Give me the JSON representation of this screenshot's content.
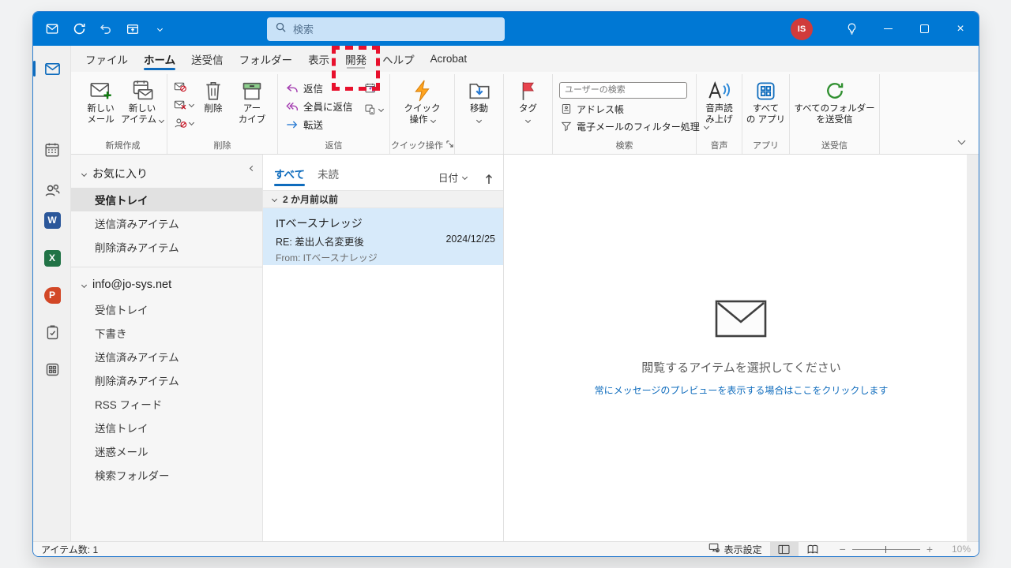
{
  "colors": {
    "accent": "#0078d4",
    "annotation": "#e8112d",
    "selection": "#d7eafa",
    "link": "#0f6cbd"
  },
  "titlebar": {
    "search_placeholder": "検索",
    "avatar_initials": "IS"
  },
  "tabs": {
    "items": [
      "ファイル",
      "ホーム",
      "送受信",
      "フォルダー",
      "表示",
      "開発",
      "ヘルプ",
      "Acrobat"
    ],
    "active": "ホーム",
    "annotated": "開発"
  },
  "ribbon": {
    "new_group": {
      "label": "新規作成",
      "new_mail_l1": "新しい",
      "new_mail_l2": "メール",
      "new_item_l1": "新しい",
      "new_item_l2": "アイテム"
    },
    "delete_group": {
      "label": "削除",
      "delete": "削除",
      "archive_l1": "アー",
      "archive_l2": "カイブ"
    },
    "reply_group": {
      "label": "返信",
      "reply": "返信",
      "reply_all": "全員に返信",
      "forward": "転送"
    },
    "quick_group": {
      "label": "クイック操作",
      "l1": "クイック",
      "l2": "操作"
    },
    "move_group": {
      "label": "移動"
    },
    "tag_group": {
      "label": "タグ"
    },
    "search_group": {
      "label": "検索",
      "user_search_placeholder": "ユーザーの検索",
      "address_book": "アドレス帳",
      "filter": "電子メールのフィルター処理"
    },
    "speech_group": {
      "label": "音声",
      "l1": "音声読",
      "l2": "み上げ"
    },
    "apps_group": {
      "label": "アプリ",
      "l1": "すべて",
      "l2": "の アプリ"
    },
    "sync_group": {
      "label": "送受信",
      "l1": "すべてのフォルダー",
      "l2": "を送受信"
    }
  },
  "folders": {
    "favorites_header": "お気に入り",
    "favorites": [
      "受信トレイ",
      "送信済みアイテム",
      "削除済みアイテム"
    ],
    "selected_favorite": "受信トレイ",
    "account_header": "info@jo-sys.net",
    "account": [
      "受信トレイ",
      "下書き",
      "送信済みアイテム",
      "削除済みアイテム",
      "RSS フィード",
      "送信トレイ",
      "迷惑メール",
      "検索フォルダー"
    ]
  },
  "list": {
    "tab_all": "すべて",
    "tab_unread": "未読",
    "sort": "日付",
    "group": "2 か月前以前",
    "message": {
      "sender": "ITベースナレッジ",
      "subject": "RE: 差出人名変更後",
      "date": "2024/12/25",
      "from": "From: ITベースナレッジ"
    }
  },
  "reading": {
    "title": "閲覧するアイテムを選択してください",
    "link": "常にメッセージのプレビューを表示する場合はここをクリックします"
  },
  "status": {
    "item_count": "アイテム数: 1",
    "display_settings": "表示設定",
    "zoom": "10%"
  }
}
